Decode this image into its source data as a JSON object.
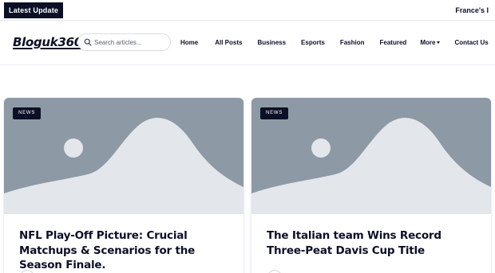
{
  "topbar": {
    "latest_label": "Latest Update",
    "ticker_text": "France's I"
  },
  "header": {
    "logo": "Bloguk360",
    "search": {
      "placeholder": "Search articles...",
      "value": ""
    },
    "nav": [
      {
        "label": "Home"
      },
      {
        "label": "All Posts"
      },
      {
        "label": "Business"
      },
      {
        "label": "Esports"
      },
      {
        "label": "Fashion"
      },
      {
        "label": "Featured"
      },
      {
        "label": "More",
        "has_dropdown": true
      },
      {
        "label": "Contact Us"
      }
    ]
  },
  "posts": [
    {
      "category": "NEWS",
      "title": "NFL Play-Off Picture: Crucial Matchups & Scenarios for the Season Finale."
    },
    {
      "category": "NEWS",
      "title": "The Italian team Wins Record Three-Peat Davis Cup Title"
    }
  ],
  "colors": {
    "brand_dark": "#0b1026",
    "thumb_bg": "#8e99a6",
    "thumb_shape": "#e3e6ea"
  }
}
